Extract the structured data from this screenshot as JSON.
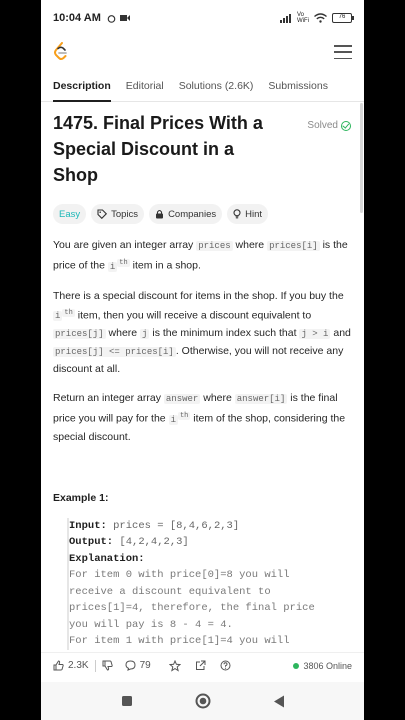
{
  "status_bar": {
    "time": "10:04 AM",
    "network": "Vo WiFi",
    "battery": "76"
  },
  "tabs": [
    {
      "label": "Description",
      "active": true
    },
    {
      "label": "Editorial"
    },
    {
      "label": "Solutions (2.6K)"
    },
    {
      "label": "Submissions"
    }
  ],
  "problem": {
    "title": "1475. Final Prices With a Special Discount in a Shop",
    "status": "Solved",
    "chips": {
      "difficulty": "Easy",
      "topics": "Topics",
      "companies": "Companies",
      "hint": "Hint"
    }
  },
  "description": {
    "p1": {
      "t1": "You are given an integer array ",
      "c1": "prices",
      "t2": " where ",
      "c2": "prices[i]",
      "t3": " is the price of the ",
      "c3": "i",
      "sup": "th",
      "t4": " item in a shop."
    },
    "p2": {
      "t1": "There is a special discount for items in the shop. If you buy the ",
      "c1": "i",
      "sup": "th",
      "t2": " item, then you will receive a discount equivalent to ",
      "c2": "prices[j]",
      "t3": " where ",
      "c3": "j",
      "t4": " is the minimum index such that ",
      "c4": "j > i",
      "t5": " and ",
      "c5": "prices[j] <= prices[i]",
      "t6": ". Otherwise, you will not receive any discount at all."
    },
    "p3": {
      "t1": "Return an integer array ",
      "c1": "answer",
      "t2": " where ",
      "c2": "answer[i]",
      "t3": " is the final price you will pay for the ",
      "c3": "i",
      "sup": "th",
      "t4": " item of the shop, considering the special discount."
    }
  },
  "example1": {
    "title": "Example 1:",
    "input_label": "Input:",
    "input_value": "prices = [8,4,6,2,3]",
    "output_label": "Output:",
    "output_value": "[4,2,4,2,3]",
    "explanation_label": "Explanation:",
    "lines": [
      "For item 0 with price[0]=8 you will",
      "receive a discount equivalent to",
      "prices[1]=4, therefore, the final price",
      "you will pay is 8 - 4 = 4.",
      "For item 1 with price[1]=4 you will"
    ]
  },
  "bottom_bar": {
    "likes": "2.3K",
    "comments": "79",
    "online": "3806 Online"
  },
  "colors": {
    "accent_green": "#2db55d",
    "easy": "#1cb8b8",
    "logo_orange": "#f89f1b"
  }
}
